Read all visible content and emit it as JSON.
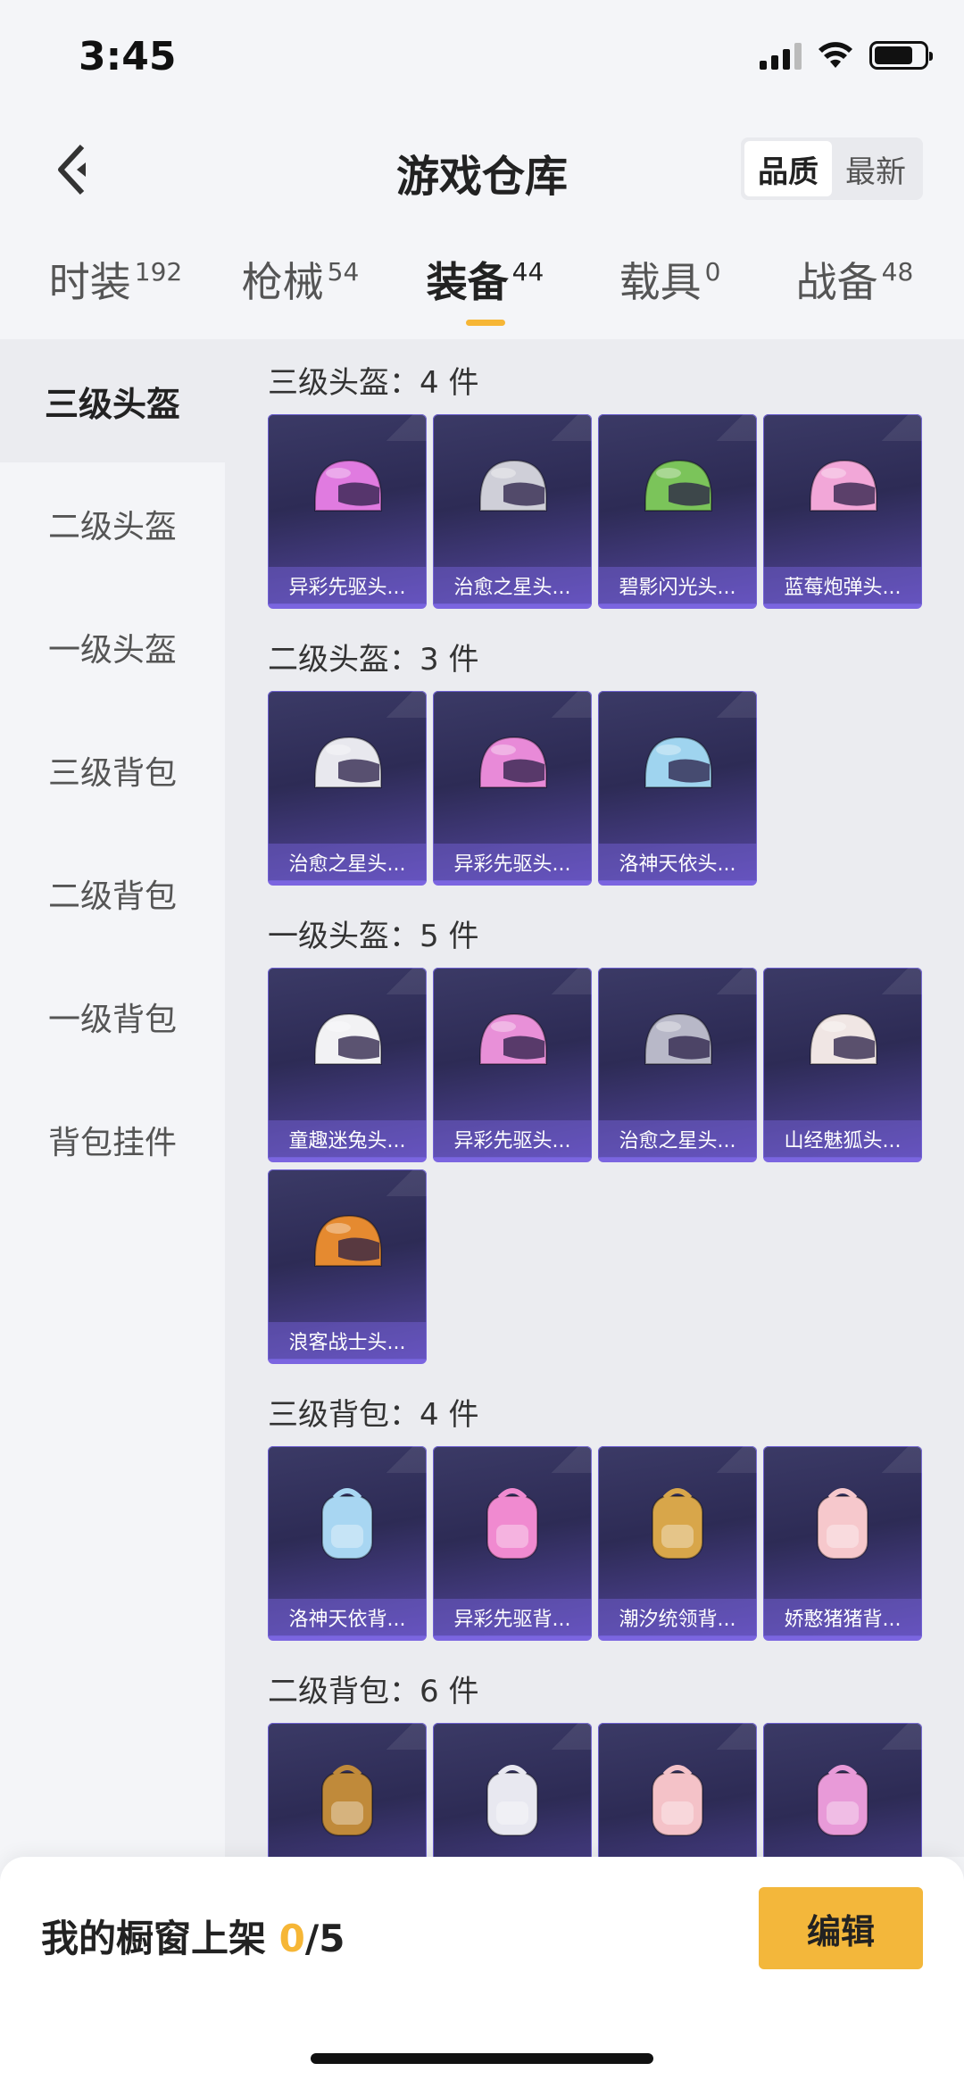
{
  "status": {
    "time": "3:45"
  },
  "header": {
    "title": "游戏仓库",
    "sort_options": [
      "品质",
      "最新"
    ]
  },
  "tabs": [
    {
      "label": "时装",
      "count": "192"
    },
    {
      "label": "枪械",
      "count": "54"
    },
    {
      "label": "装备",
      "count": "44"
    },
    {
      "label": "载具",
      "count": "0"
    },
    {
      "label": "战备",
      "count": "48"
    }
  ],
  "sidebar": [
    "三级头盔",
    "二级头盔",
    "一级头盔",
    "三级背包",
    "二级背包",
    "一级背包",
    "背包挂件"
  ],
  "sections": [
    {
      "title": "三级头盔：4 件",
      "items": [
        {
          "name": "异彩先驱头...",
          "color": "#e07be0"
        },
        {
          "name": "治愈之星头...",
          "color": "#cfcfd8"
        },
        {
          "name": "碧影闪光头...",
          "color": "#7bc45a"
        },
        {
          "name": "蓝莓炮弹头...",
          "color": "#f2a7d8"
        }
      ]
    },
    {
      "title": "二级头盔：3 件",
      "items": [
        {
          "name": "治愈之星头...",
          "color": "#e8e8ee"
        },
        {
          "name": "异彩先驱头...",
          "color": "#e88ad8"
        },
        {
          "name": "洛神天依头...",
          "color": "#9fd4ef"
        }
      ]
    },
    {
      "title": "一级头盔：5 件",
      "items": [
        {
          "name": "童趣迷兔头...",
          "color": "#f2f2f4"
        },
        {
          "name": "异彩先驱头...",
          "color": "#e890d8"
        },
        {
          "name": "治愈之星头...",
          "color": "#b8b8c8"
        },
        {
          "name": "山经魅狐头...",
          "color": "#f0e6e4"
        },
        {
          "name": "浪客战士头...",
          "color": "#e58a30"
        }
      ]
    },
    {
      "title": "三级背包：4 件",
      "items": [
        {
          "name": "洛神天依背...",
          "color": "#a8d6f2"
        },
        {
          "name": "异彩先驱背...",
          "color": "#f08ad0"
        },
        {
          "name": "潮汐统领背...",
          "color": "#d8a64a"
        },
        {
          "name": "娇憨猪猪背...",
          "color": "#f6c8cc"
        }
      ]
    },
    {
      "title": "二级背包：6 件",
      "items": [
        {
          "name": "",
          "color": "#c08a3a"
        },
        {
          "name": "",
          "color": "#e8e8f0"
        },
        {
          "name": "",
          "color": "#f4c2c8"
        },
        {
          "name": "",
          "color": "#e89ad8"
        }
      ]
    }
  ],
  "bottom": {
    "showcase_prefix": "我的橱窗上架 ",
    "showcase_count": "0",
    "showcase_total": "/5",
    "edit_label": "编辑"
  }
}
